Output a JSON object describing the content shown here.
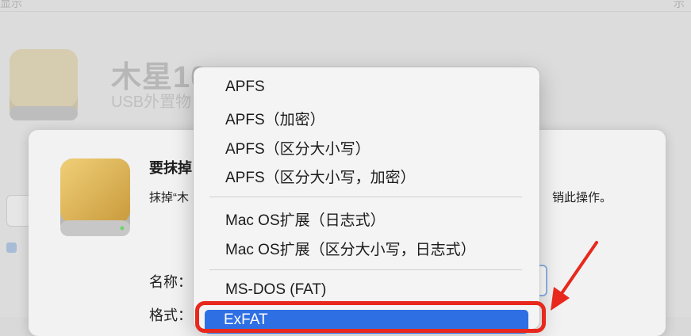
{
  "background": {
    "toolbar_left": "显示",
    "toolbar_right": "示",
    "drive_title": "木星10",
    "drive_subtitle": "USB外置物"
  },
  "dialog": {
    "title": "要抹掉",
    "description": "抹掉“木",
    "description_end": "销此操作。",
    "name_label": "名称：",
    "format_label": "格式："
  },
  "format_menu": {
    "items": [
      "APFS",
      "APFS（加密）",
      "APFS（区分大小写）",
      "APFS（区分大小写，加密）",
      "Mac OS扩展（日志式）",
      "Mac OS扩展（区分大小写，日志式）",
      "MS-DOS (FAT)",
      "ExFAT"
    ],
    "selected": "ExFAT"
  },
  "colors": {
    "highlight": "#e8281c",
    "selection": "#2f6fe4",
    "drive_gold": "#d9b25a"
  }
}
